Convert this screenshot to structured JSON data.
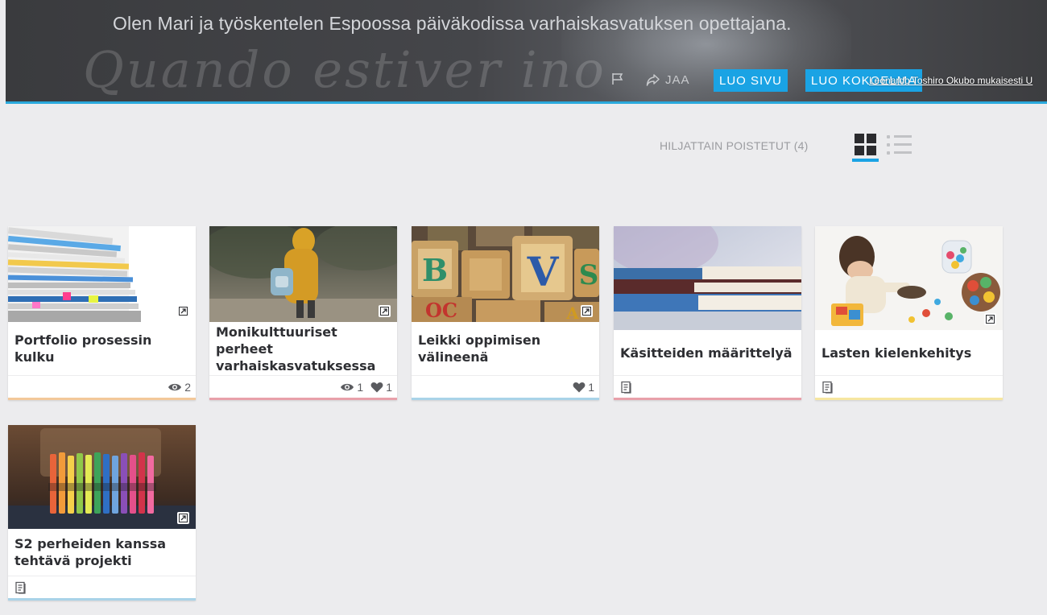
{
  "header": {
    "intro": "Olen Mari ja työskentelen Espoossa päiväkodissa varhaiskasvatuksen opettajana.",
    "chalk_text": "Quando estiver ino",
    "share_label": "JAA",
    "create_page_label": "LUO SIVU",
    "create_collection_label": "LUO KOKOELMA",
    "image_credit": "Leonardo Toshiro Okubo mukaisesti U",
    "accent_color": "#2aa9dc"
  },
  "toolbar": {
    "recently_deleted": "HILJATTAIN POISTETUT (4)",
    "active_view": "grid"
  },
  "cards": [
    {
      "title": "Portfolio prosessin kulku",
      "views": "2",
      "likes": "",
      "accent": "#f3c89a",
      "image": "stack-of-binders",
      "external": true
    },
    {
      "title": "Monikulttuuriset perheet varhaiskasvatuksessa",
      "views": "1",
      "likes": "1",
      "accent": "#e8a0aa",
      "image": "child-in-yellow-raincoat",
      "external": true
    },
    {
      "title": "Leikki oppimisen välineenä",
      "views": "",
      "likes": "1",
      "accent": "#a9d3e8",
      "image": "wooden-letter-blocks",
      "external": true
    },
    {
      "title": "Käsitteiden määrittelyä",
      "views": "",
      "likes": "",
      "accent": "#e8a0aa",
      "image": "stacked-books",
      "external": false,
      "page_icon": true
    },
    {
      "title": "Lasten kielenkehitys",
      "views": "",
      "likes": "",
      "accent": "#f6e6a0",
      "image": "toddler-playing-with-toys",
      "external": true,
      "page_icon": true
    },
    {
      "title": "S2 perheiden kanssa tehtävä projekti",
      "views": "",
      "likes": "",
      "accent": "#a9d3e8",
      "image": "colored-crayons",
      "external": true,
      "page_icon": true
    }
  ]
}
